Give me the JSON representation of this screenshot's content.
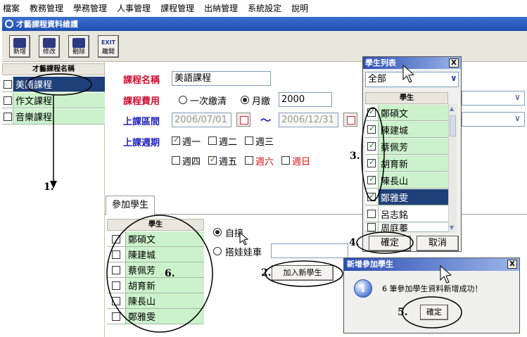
{
  "menu": [
    "檔案",
    "教務管理",
    "學務管理",
    "人事管理",
    "課程管理",
    "出納管理",
    "系統設定",
    "說明"
  ],
  "window_title": "才藝課程資料維護",
  "toolbar": {
    "new": "新增",
    "edit": "修改",
    "delete": "刪除",
    "exit": "離開",
    "exit_top": "EXIT"
  },
  "course_list": {
    "header": "才藝課程名稱",
    "items": [
      {
        "label": "美語課程",
        "selected": true
      },
      {
        "label": "作文課程",
        "selected": false
      },
      {
        "label": "音樂課程",
        "selected": false
      }
    ]
  },
  "form": {
    "name_label": "課程名稱",
    "name_value": "美語課程",
    "fee_label": "課程費用",
    "fee_option_once": "一次繳清",
    "fee_option_monthly": "月繳",
    "fee_value": "2000",
    "period_label": "上課區間",
    "start_date": "2006/07/01",
    "tilde": "～",
    "end_date": "2006/12/31",
    "week_label": "上課週期",
    "days": [
      {
        "label": "週一",
        "checked": true,
        "weekend": false
      },
      {
        "label": "週二",
        "checked": false,
        "weekend": false
      },
      {
        "label": "週三",
        "checked": false,
        "weekend": false
      },
      {
        "label": "週四",
        "checked": false,
        "weekend": false
      },
      {
        "label": "週五",
        "checked": true,
        "weekend": false
      },
      {
        "label": "週六",
        "checked": false,
        "weekend": true
      },
      {
        "label": "週日",
        "checked": false,
        "weekend": true
      }
    ]
  },
  "tab": {
    "label": "參加學生"
  },
  "participants": {
    "header": "學生",
    "rows": [
      "鄭碩文",
      "陳建城",
      "蔡佩芳",
      "胡育新",
      "陳長山",
      "鄭雅雯"
    ]
  },
  "transport": {
    "self": "自接",
    "bus": "搭娃娃車"
  },
  "add_student_button": "加入新學生",
  "student_popup": {
    "title": "學生列表",
    "filter": "全部",
    "header": "學生",
    "rows": [
      {
        "name": "鄭碩文",
        "checked": true,
        "selected": false
      },
      {
        "name": "陳建城",
        "checked": true,
        "selected": false
      },
      {
        "name": "蔡佩芳",
        "checked": true,
        "selected": false
      },
      {
        "name": "胡育新",
        "checked": true,
        "selected": false
      },
      {
        "name": "陳長山",
        "checked": true,
        "selected": false
      },
      {
        "name": "鄭雅雯",
        "checked": true,
        "selected": true
      },
      {
        "name": "呂志銘",
        "checked": false,
        "selected": false
      },
      {
        "name": "周庭蓁",
        "checked": false,
        "selected": false
      }
    ],
    "ok": "確定",
    "cancel": "取消"
  },
  "dialog": {
    "title": "新增參加學生",
    "message": "6 筆參加學生資料新增成功！",
    "ok": "確定"
  },
  "annotations": [
    "1.",
    "2.",
    "3.",
    "4.",
    "5.",
    "6."
  ],
  "close_glyph": "X",
  "dropdown_glyph": "∨"
}
